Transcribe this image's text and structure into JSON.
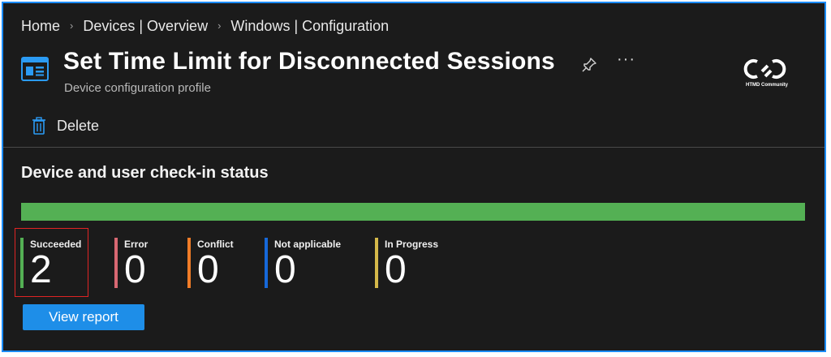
{
  "breadcrumb": [
    "Home",
    "Devices | Overview",
    "Windows | Configuration"
  ],
  "header": {
    "title": "Set Time Limit for Disconnected Sessions",
    "subtitle": "Device configuration profile",
    "more_label": "···"
  },
  "logo": {
    "text": "HTMD Community"
  },
  "toolbar": {
    "delete_label": "Delete"
  },
  "section": {
    "title": "Device and user check-in status",
    "progress_fraction_succeeded": 1.0
  },
  "stats": [
    {
      "label": "Succeeded",
      "value": "2",
      "color": "#54b054"
    },
    {
      "label": "Error",
      "value": "0",
      "color": "#d86872"
    },
    {
      "label": "Conflict",
      "value": "0",
      "color": "#f07c28"
    },
    {
      "label": "Not applicable",
      "value": "0",
      "color": "#1668d9"
    },
    {
      "label": "In Progress",
      "value": "0",
      "color": "#d4b84a"
    }
  ],
  "buttons": {
    "view_report": "View report"
  },
  "colors": {
    "accent": "#1e8ee8",
    "background": "#1b1b1b",
    "highlight": "#e02424"
  }
}
